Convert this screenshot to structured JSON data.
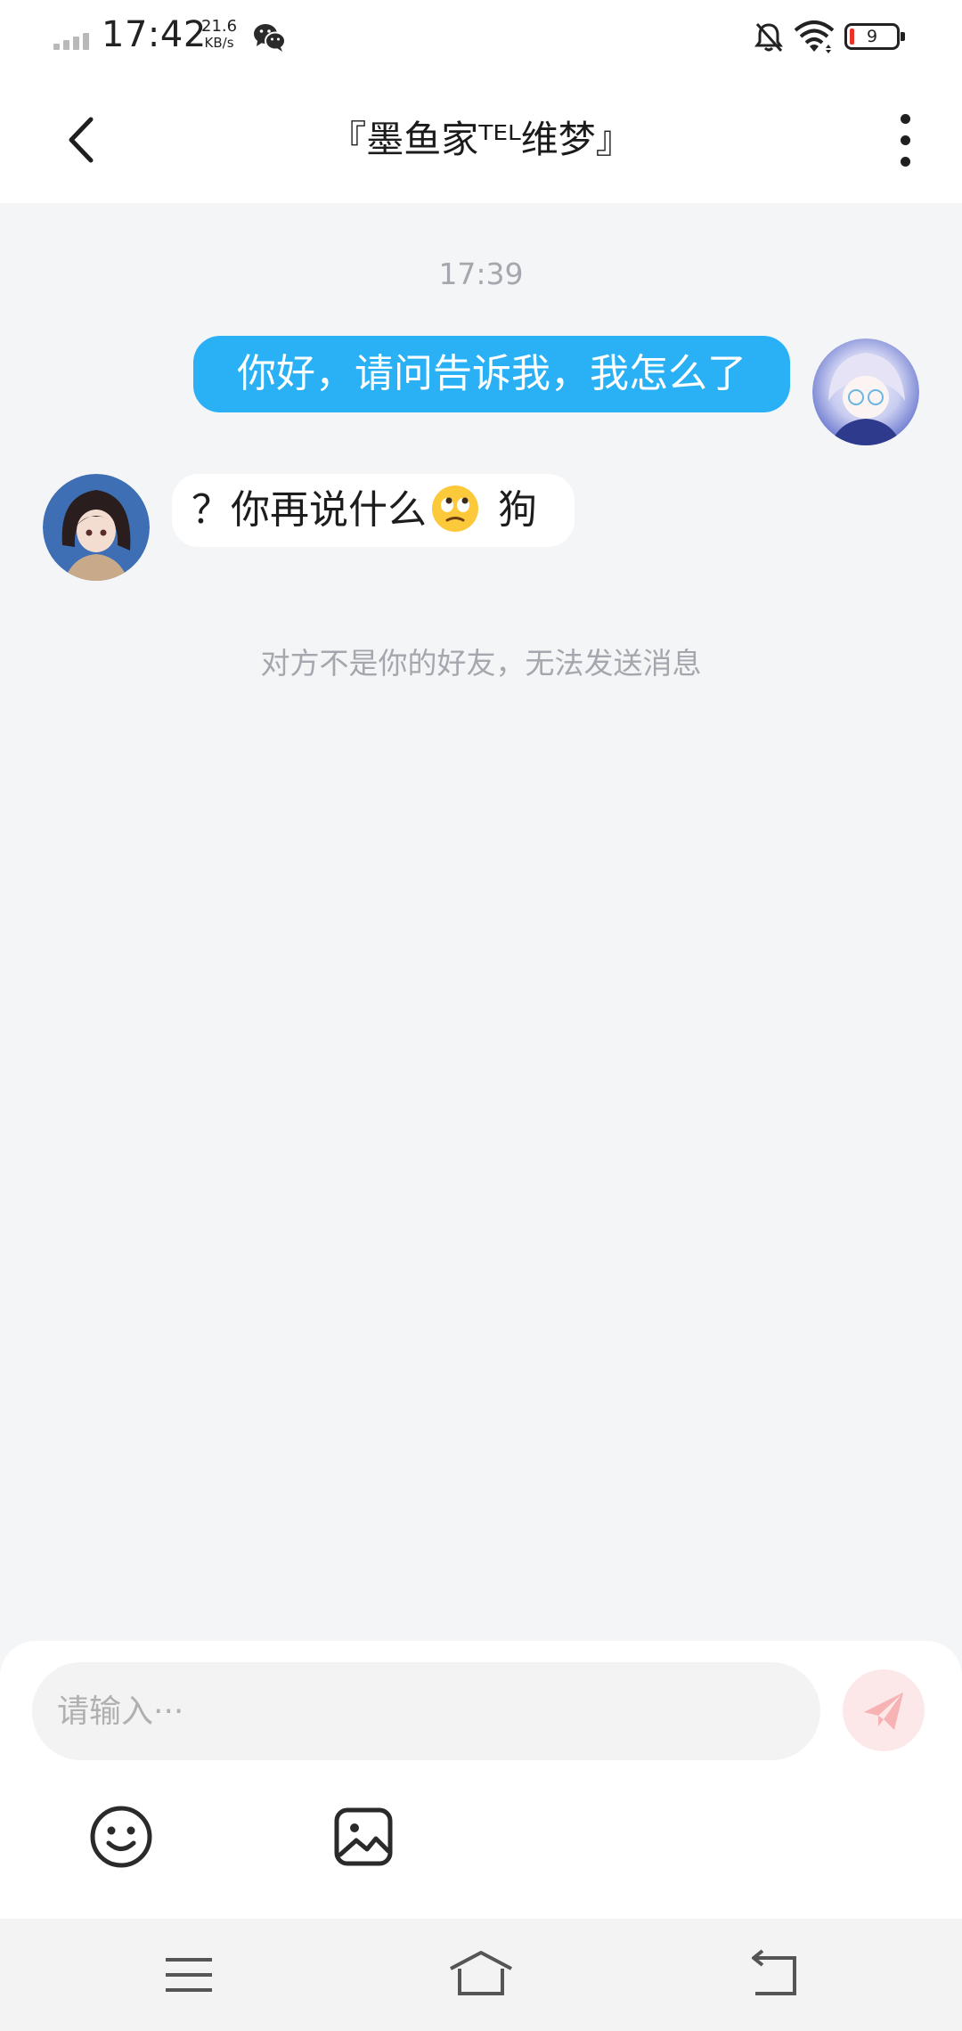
{
  "status_bar": {
    "time": "17:42",
    "net_speed_value": "21.6",
    "net_speed_unit": "KB/s",
    "battery_level": "9",
    "icons": [
      "signal-icon",
      "wechat-icon",
      "mute-bell-icon",
      "wifi-icon",
      "battery-icon"
    ]
  },
  "header": {
    "title": "『墨鱼家ᵀᴱᴸ维梦』",
    "back_icon": "back-arrow-icon",
    "more_icon": "more-vertical-icon"
  },
  "chat": {
    "timestamp": "17:39",
    "messages": [
      {
        "side": "outgoing",
        "text": "你好，请问告诉我，我怎么了"
      },
      {
        "side": "incoming",
        "text_before": "？你再说什么",
        "emoji": "eye-roll-emoji",
        "text_after": " 狗"
      }
    ],
    "notice": "对方不是你的好友，无法发送消息"
  },
  "input": {
    "placeholder": "请输入···",
    "send_icon": "send-paper-plane-icon",
    "tools": [
      "emoji-icon",
      "image-icon"
    ]
  },
  "colors": {
    "outgoing_bubble": "#2ab0f4",
    "background": "#f4f5f7",
    "send_button_bg": "#fde8e9",
    "send_icon": "#f7b2b4"
  }
}
